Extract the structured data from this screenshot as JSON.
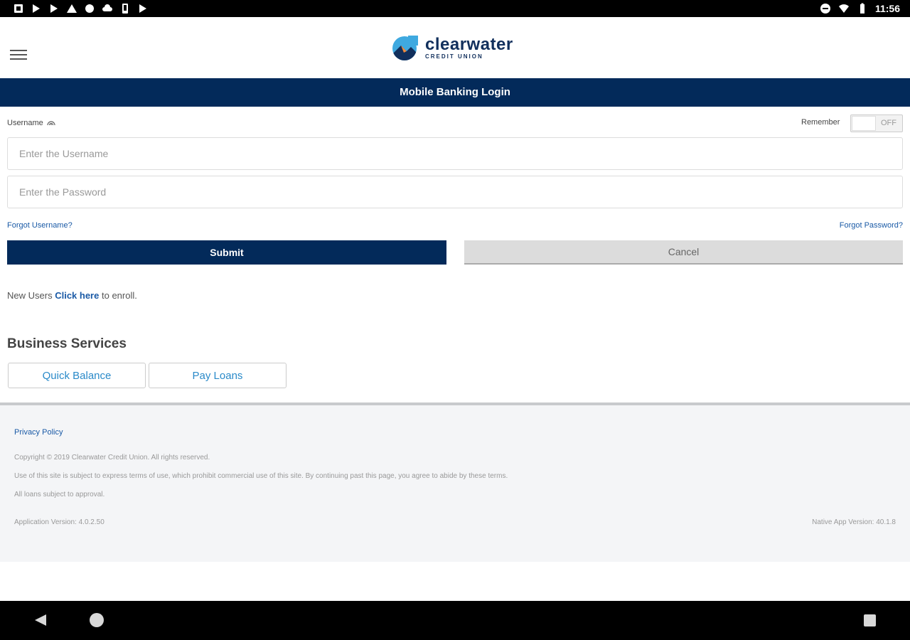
{
  "status_bar": {
    "time": "11:56",
    "left_icons": [
      "notification-icon",
      "play-store-icon",
      "play-store-icon",
      "warning-icon",
      "circle-icon",
      "cloud-icon",
      "phone-icon",
      "play-store-icon"
    ],
    "right_icons": [
      "do-not-disturb-icon",
      "wifi-icon",
      "battery-icon"
    ]
  },
  "header": {
    "logo_name": "clearwater",
    "logo_sub": "CREDIT UNION",
    "brand_color": "#032a5a"
  },
  "title_bar": {
    "title": "Mobile Banking Login"
  },
  "form": {
    "username_label": "Username",
    "remember_label": "Remember",
    "remember_state": "OFF",
    "username_placeholder": "Enter the Username",
    "password_placeholder": "Enter the Password",
    "forgot_username": "Forgot Username?",
    "forgot_password": "Forgot Password?",
    "submit_label": "Submit",
    "cancel_label": "Cancel"
  },
  "enroll": {
    "prefix": "New Users",
    "link": "Click here",
    "suffix": "to enroll."
  },
  "business": {
    "heading": "Business Services",
    "quick_balance": "Quick Balance",
    "pay_loans": "Pay Loans"
  },
  "footer": {
    "privacy": "Privacy Policy",
    "copyright": "Copyright © 2019 Clearwater Credit Union. All rights reserved.",
    "terms": "Use of this site is subject to express terms of use, which prohibit commercial use of this site. By continuing past this page, you agree to abide by these terms.",
    "loans_note": "All loans subject to approval.",
    "app_version": "Application Version: 4.0.2.50",
    "native_version": "Native App Version: 40.1.8"
  }
}
